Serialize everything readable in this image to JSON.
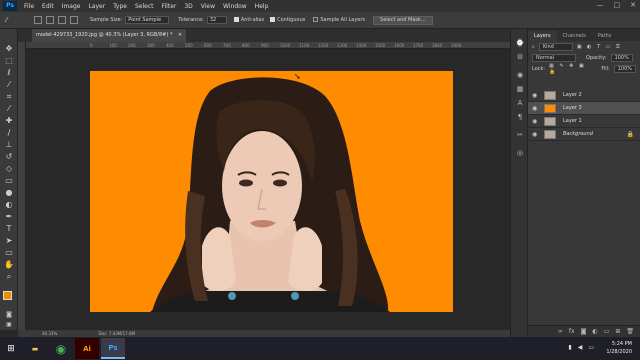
{
  "menubar": {
    "logo": "Ps",
    "items": [
      "File",
      "Edit",
      "Image",
      "Layer",
      "Type",
      "Select",
      "Filter",
      "3D",
      "View",
      "Window",
      "Help"
    ],
    "window_controls": [
      "—",
      "□",
      "✕"
    ]
  },
  "options": {
    "sample_size_label": "Sample Size:",
    "sample_size_value": "Point Sample",
    "tolerance_label": "Tolerance:",
    "tolerance_value": "32",
    "anti_alias": "Anti-alias",
    "contiguous": "Contiguous",
    "sample_all_layers": "Sample All Layers",
    "select_mask_button": "Select and Mask..."
  },
  "document": {
    "tab_title": "model-429733_1920.jpg @ 40.3% (Layer 3, RGB/8#) *",
    "tab_close": "×",
    "ruler_ticks": [
      "0",
      "100",
      "200",
      "300",
      "400",
      "500",
      "600",
      "700",
      "800",
      "900",
      "1000",
      "1100",
      "1200",
      "1300",
      "1400",
      "1500",
      "1600",
      "1700",
      "1800",
      "1900"
    ]
  },
  "status": {
    "zoom": "40.33%",
    "doc_size": "Doc: 7.03M/17.6M"
  },
  "layers_panel": {
    "tabs": [
      "Layers",
      "Channels",
      "Paths"
    ],
    "kind_label": "Kind",
    "blend_mode": "Normal",
    "opacity_label": "Opacity:",
    "opacity_value": "100%",
    "lock_label": "Lock:",
    "fill_label": "Fill:",
    "fill_value": "100%",
    "layers": [
      {
        "name": "Layer 2",
        "selected": false,
        "italic": false,
        "thumb": "#b9a99a"
      },
      {
        "name": "Layer 3",
        "selected": true,
        "italic": false,
        "thumb": "#ff8c00"
      },
      {
        "name": "Layer 1",
        "selected": false,
        "italic": false,
        "thumb": "#b9a99a"
      },
      {
        "name": "Background",
        "selected": false,
        "italic": true,
        "thumb": "#b9a99a"
      }
    ]
  },
  "colors": {
    "foreground": "#f08a00",
    "background": "#6a1b9a",
    "canvas_fill": "#ff8c00"
  },
  "taskbar": {
    "apps": [
      "Ai",
      "Ps"
    ],
    "time": "5:24 PM",
    "date": "1/28/2020"
  }
}
